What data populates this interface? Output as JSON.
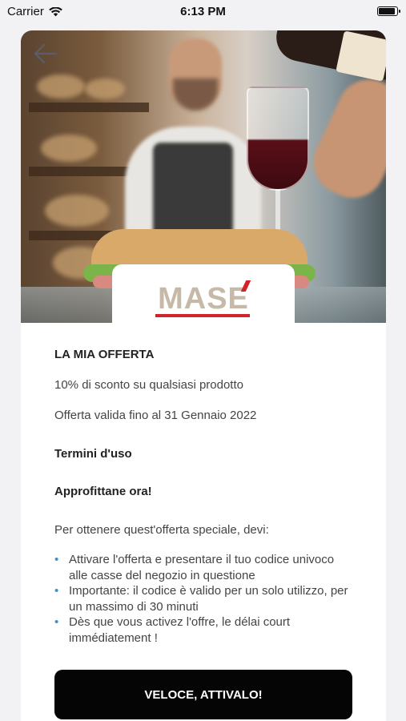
{
  "status_bar": {
    "carrier": "Carrier",
    "time": "6:13 PM",
    "battery_level": 0.9
  },
  "header": {
    "back_icon": "arrow-left-icon"
  },
  "brand": {
    "logo_text": "MASE",
    "logo_accent_color": "#d1232a"
  },
  "offer": {
    "title": "LA MIA OFFERTA",
    "description": "10% di sconto su qualsiasi prodotto",
    "validity": "Offerta valida fino al 31 Gennaio 2022"
  },
  "terms": {
    "title": "Termini d'uso",
    "cta_title": "Approfittane ora!",
    "intro": "Per ottenere quest'offerta speciale, devi:",
    "items": [
      "Attivare l'offerta e presentare il tuo codice univoco alle casse del negozio in questione",
      "Importante: il codice è valido per un solo utilizzo, per un massimo di 30 minuti",
      "Dès que vous activez l'offre, le délai court immédiatement !"
    ]
  },
  "actions": {
    "activate_label": "VELOCE, ATTIVALO!"
  },
  "colors": {
    "bullet": "#3a8fd0",
    "button_bg": "#050505",
    "button_text": "#ffffff"
  }
}
